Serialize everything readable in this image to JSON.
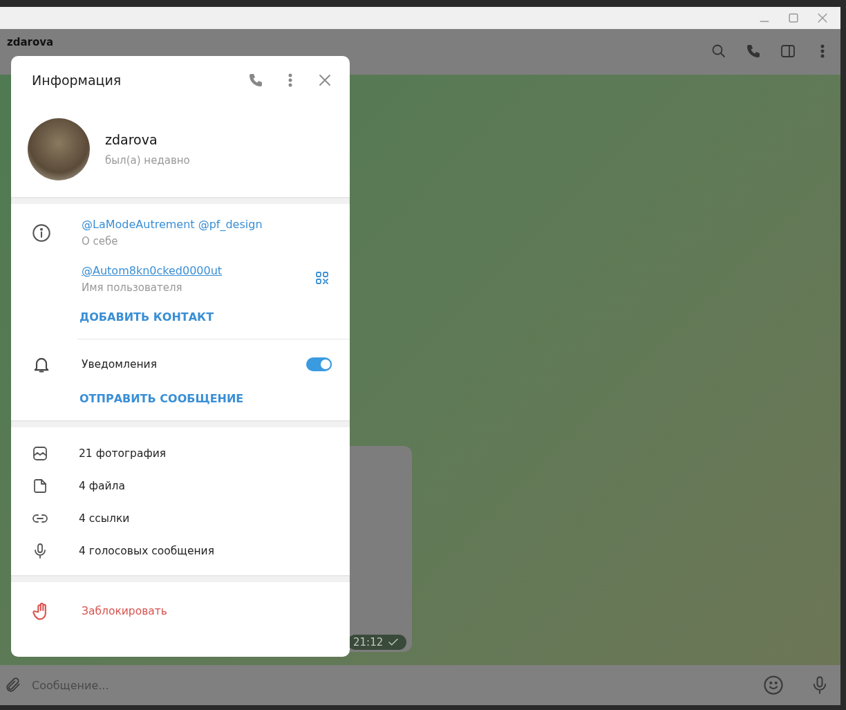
{
  "chat_header": {
    "title": "zdarova"
  },
  "message": {
    "time": "21:12"
  },
  "composer": {
    "placeholder": "Сообщение..."
  },
  "info_panel": {
    "title": "Информация",
    "profile": {
      "name": "zdarova",
      "status": "был(а) недавно"
    },
    "about": {
      "value": "@LaModeAutrement @pf_design",
      "label": "О себе"
    },
    "username": {
      "value": "@Autom8kn0cked0000ut",
      "label": "Имя пользователя"
    },
    "add_contact": "ДОБАВИТЬ КОНТАКТ",
    "notifications": {
      "label": "Уведомления",
      "on": true
    },
    "send_message": "ОТПРАВИТЬ СООБЩЕНИЕ",
    "media": [
      {
        "kind": "photo",
        "label": "21 фотография"
      },
      {
        "kind": "file",
        "label": "4 файла"
      },
      {
        "kind": "link",
        "label": "4 ссылки"
      },
      {
        "kind": "voice",
        "label": "4 голосовых сообщения"
      }
    ],
    "block": "Заблокировать"
  }
}
